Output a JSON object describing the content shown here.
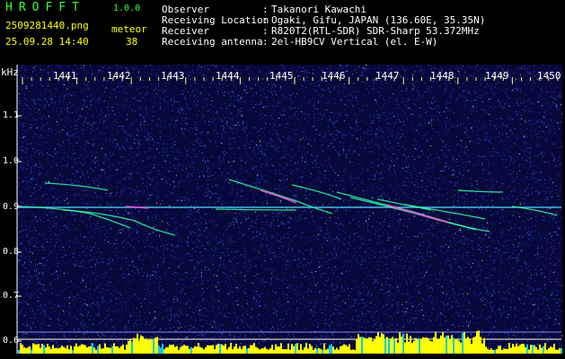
{
  "header": {
    "logo": "HROFFT",
    "version": "1.0.0",
    "filename": "2509281440.png",
    "datetime": "25.09.28 14:40",
    "meteor_label": "meteor",
    "meteor_count": "38",
    "observer_label": "Observer",
    "observer_value": "Takanori Kawachi",
    "location_label": "Receiving Location",
    "location_value": "Ogaki, Gifu, JAPAN (136.60E, 35.35N)",
    "receiver_label": "Receiver",
    "receiver_value": "R820T2(RTL-SDR) SDR-Sharp 53.372MHz",
    "antenna_label": "Receiving antenna",
    "antenna_value": "2el-HB9CV Vertical (el. E-W)",
    "colon": ":"
  },
  "axes": {
    "y_unit": "kHz",
    "y_ticks": [
      "1.1",
      "1.0",
      "0.9",
      "0.8",
      "0.7",
      "0.6"
    ],
    "x_ticks": [
      "1441",
      "1442",
      "1443",
      "1444",
      "1445",
      "1446",
      "1447",
      "1448",
      "1449",
      "1450"
    ]
  },
  "colors": {
    "label_green": "#33ff33",
    "label_yellow": "#ffff00",
    "background": "#06093a",
    "noise": "#3a4cff",
    "signal": "#00ffcc",
    "bar_yellow": "#ffff00",
    "bar_cyan": "#00ccff"
  }
}
